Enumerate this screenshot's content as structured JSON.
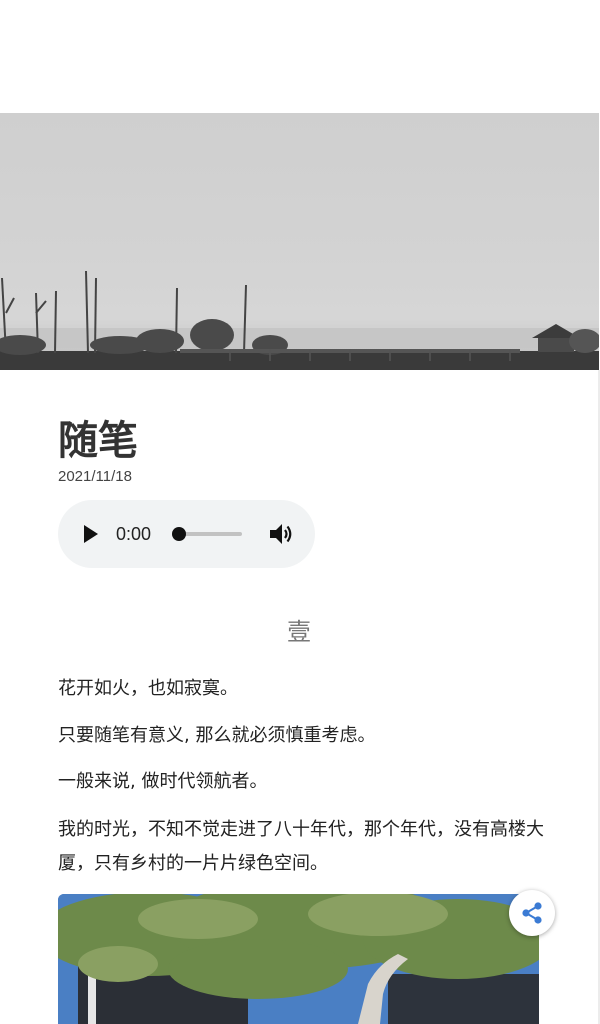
{
  "article": {
    "title": "随笔",
    "date": "2021/11/18",
    "section_number": "壹",
    "paragraphs": [
      "花开如火，也如寂寞。",
      "只要随笔有意义, 那么就必须慎重考虑。",
      "一般来说, 做时代领航者。",
      "我的时光，不知不觉走进了八十年代，那个年代，没有高楼大厦，只有乡村的一片片绿色空间。"
    ]
  },
  "audio_player": {
    "time": "0:00",
    "progress": 0,
    "play_icon": "play-icon",
    "volume_icon": "volume-icon"
  },
  "images": {
    "hero": "foggy-lakeside-landscape",
    "inline": "tree-and-building-photo"
  },
  "share_button": {
    "icon": "share-icon",
    "color": "#3b7bd4"
  }
}
